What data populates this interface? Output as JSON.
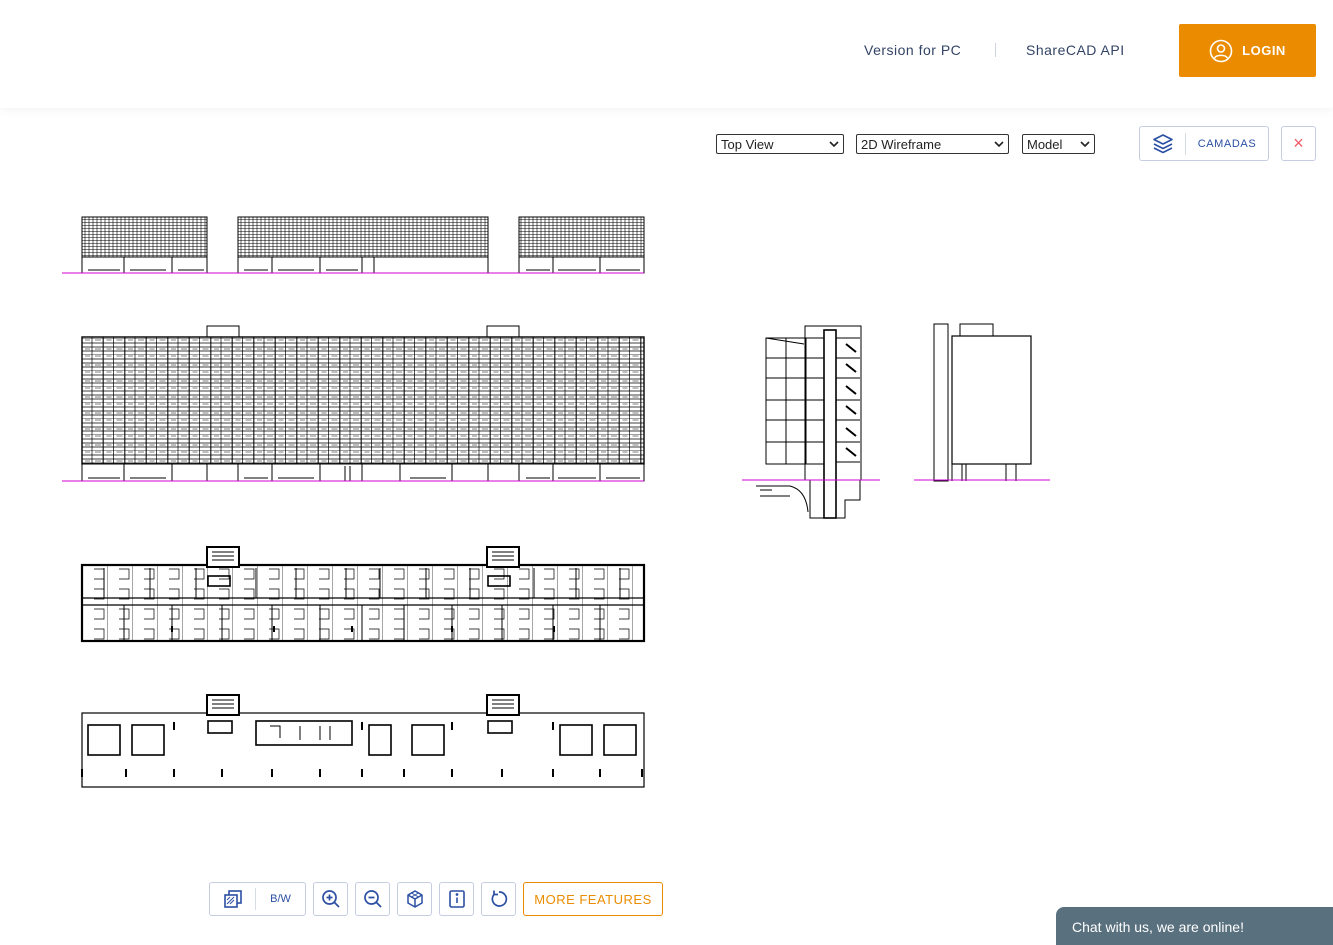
{
  "header": {
    "nav": [
      {
        "label": "Version for PC"
      },
      {
        "label": "ShareCAD API"
      }
    ],
    "login_label": "LOGIN"
  },
  "viewer": {
    "view_select": "Top View",
    "style_select": "2D Wireframe",
    "space_select": "Model",
    "layers_label": "CAMADAS",
    "close_label": "×"
  },
  "toolbar": {
    "bw_label": "B/W",
    "more_label": "MORE FEATURES"
  },
  "chat": {
    "label": "Chat with us, we are online!"
  },
  "colors": {
    "accent": "#eb8c00",
    "nav_text": "#334466",
    "icon_blue": "#2b4fa3",
    "ground_line": "#d100d1",
    "chat_bg": "#59707e"
  },
  "icons": [
    "user-icon",
    "layers-icon",
    "close-icon",
    "background-toggle-icon",
    "zoom-in-icon",
    "zoom-out-icon",
    "cube-3d-icon",
    "info-icon",
    "rotate-icon",
    "chevron-down-icon"
  ]
}
